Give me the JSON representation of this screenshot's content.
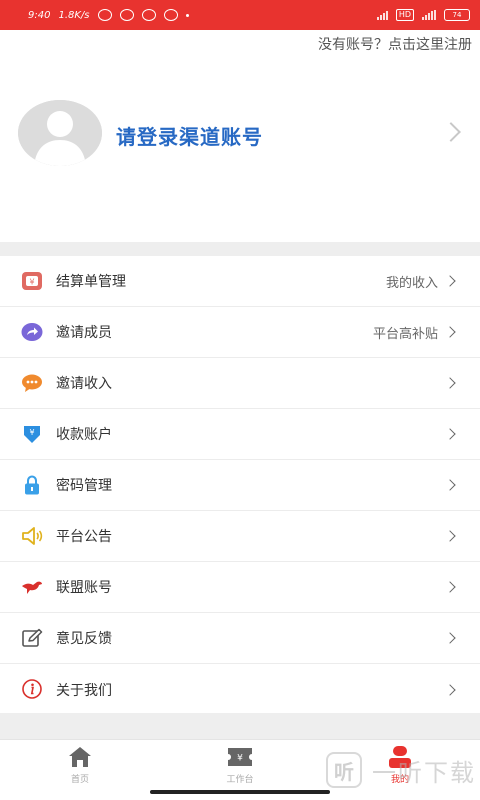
{
  "status_bar": {
    "time": "9:40",
    "speed": "1.8K/s",
    "hd": "HD",
    "battery": "74"
  },
  "header": {
    "register_link": "没有账号？点击这里注册"
  },
  "profile": {
    "login_prompt": "请登录渠道账号"
  },
  "menu": {
    "items": [
      {
        "label": "结算单管理",
        "aside": "我的收入",
        "icon": "wallet-icon",
        "color": "#e06a62"
      },
      {
        "label": "邀请成员",
        "aside": "平台高补贴",
        "icon": "share-icon",
        "color": "#7a67d8"
      },
      {
        "label": "邀请收入",
        "aside": "",
        "icon": "chat-icon",
        "color": "#f08a2e"
      },
      {
        "label": "收款账户",
        "aside": "",
        "icon": "yen-down-icon",
        "color": "#2c8fe0"
      },
      {
        "label": "密码管理",
        "aside": "",
        "icon": "lock-icon",
        "color": "#3aa0e8"
      },
      {
        "label": "平台公告",
        "aside": "",
        "icon": "speaker-icon",
        "color": "#e0b21e"
      },
      {
        "label": "联盟账号",
        "aside": "",
        "icon": "bird-icon",
        "color": "#d9302c"
      },
      {
        "label": "意见反馈",
        "aside": "",
        "icon": "edit-icon",
        "color": "#555555"
      },
      {
        "label": "关于我们",
        "aside": "",
        "icon": "info-icon",
        "color": "#d9302c"
      }
    ]
  },
  "tabbar": {
    "tabs": [
      {
        "label": "首页",
        "icon": "home-icon"
      },
      {
        "label": "工作台",
        "icon": "ticket-icon"
      },
      {
        "label": "我的",
        "icon": "user-icon"
      }
    ],
    "active_color": "#e8332f"
  },
  "watermark": {
    "badge": "听",
    "text": "一听下载"
  },
  "colors": {
    "brand_red": "#e8332f",
    "login_blue": "#2769c4"
  }
}
